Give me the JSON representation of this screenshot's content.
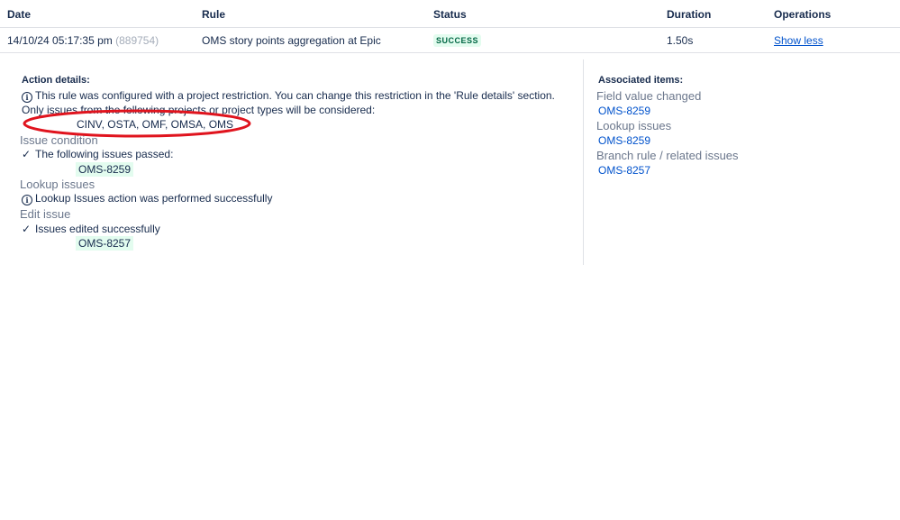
{
  "table": {
    "headers": {
      "date": "Date",
      "rule": "Rule",
      "status": "Status",
      "duration": "Duration",
      "operations": "Operations"
    },
    "row": {
      "date": "14/10/24 05:17:35 pm",
      "id": "(889754)",
      "rule": "OMS story points aggregation at Epic",
      "status": "SUCCESS",
      "duration": "1.50s",
      "operation": "Show less"
    }
  },
  "details": {
    "action_details_label": "Action details:",
    "restriction_text": "This rule was configured with a project restriction. You can change this restriction in the 'Rule details' section. Only issues from the following projects or project types will be considered:",
    "projects": "CINV, OSTA, OMF, OMSA, OMS",
    "issue_condition": {
      "title": "Issue condition",
      "message": "The following issues passed:",
      "issue": "OMS-8259"
    },
    "lookup_issues": {
      "title": "Lookup issues",
      "message": "Lookup Issues action was performed successfully"
    },
    "edit_issue": {
      "title": "Edit issue",
      "message": "Issues edited successfully",
      "issue": "OMS-8257"
    }
  },
  "associated": {
    "label": "Associated items:",
    "groups": [
      {
        "title": "Field value changed",
        "issue": "OMS-8259"
      },
      {
        "title": "Lookup issues",
        "issue": "OMS-8259"
      },
      {
        "title": "Branch rule / related issues",
        "issue": "OMS-8257"
      }
    ]
  },
  "colors": {
    "success_bg": "#e3fcef",
    "success_text": "#006644",
    "link": "#0052cc",
    "annotation": "#e0141e"
  },
  "icons": {
    "info": "info-icon",
    "check": "check-icon"
  }
}
